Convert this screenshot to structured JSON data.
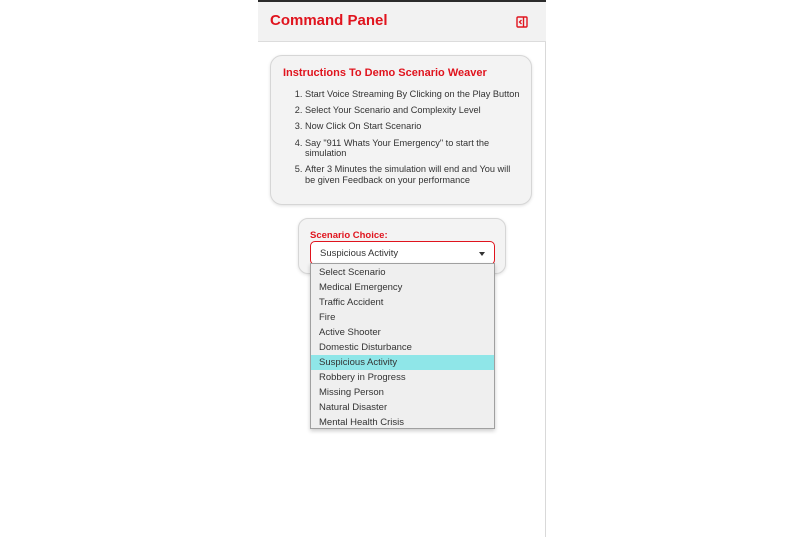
{
  "header": {
    "title": "Command Panel",
    "collapse_icon": "sidebar-collapse-icon"
  },
  "instructions": {
    "title": "Instructions To Demo Scenario Weaver",
    "steps": [
      "Start Voice Streaming By Clicking on the Play Button",
      "Select Your Scenario and Complexity Level",
      "Now Click On Start Scenario",
      "Say \"911 Whats Your Emergency\" to start the simulation",
      "After 3 Minutes the simulation will end and You will be given Feedback on your performance"
    ]
  },
  "scenario": {
    "label": "Scenario Choice:",
    "selected": "Suspicious Activity",
    "options": [
      "Select Scenario",
      "Medical Emergency",
      "Traffic Accident",
      "Fire",
      "Active Shooter",
      "Domestic Disturbance",
      "Suspicious Activity",
      "Robbery in Progress",
      "Missing Person",
      "Natural Disaster",
      "Mental Health Crisis"
    ]
  },
  "colors": {
    "accent": "#e0141e",
    "highlight": "#8fe6e8",
    "card_bg": "#f3f3f3"
  }
}
